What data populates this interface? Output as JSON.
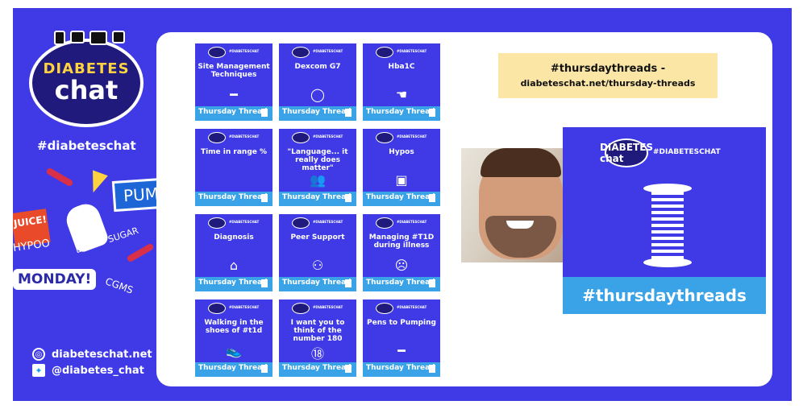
{
  "sidebar": {
    "logo_line1": "DIABETES",
    "logo_line2": "chat",
    "hashtag": "#diabeteschat",
    "collage": {
      "pump": "PUMP!",
      "juice": "JUICE!",
      "hypo": "HYPOO",
      "blood_sugar": "BLOOD SUGAR",
      "monday": "MONDAY!",
      "cgms": "CGMS"
    },
    "website": "diabeteschat.net",
    "twitter": "@diabetes_chat"
  },
  "tiles": [
    {
      "title": "Site Management Techniques",
      "glyph": "━"
    },
    {
      "title": "Dexcom G7",
      "glyph": "◯"
    },
    {
      "title": "Hba1C",
      "glyph": "☚"
    },
    {
      "title": "Time in range %",
      "glyph": ""
    },
    {
      "title": "\"Language... it really does matter\"",
      "glyph": "👥"
    },
    {
      "title": "Hypos",
      "glyph": "▣"
    },
    {
      "title": "Diagnosis",
      "glyph": "⌂"
    },
    {
      "title": "Peer Support",
      "glyph": "⚇"
    },
    {
      "title": "Managing #T1D during illness",
      "glyph": "☹"
    },
    {
      "title": "Walking in the shoes of #t1d",
      "glyph": "👟"
    },
    {
      "title": "I want you to think of the number 180",
      "glyph": "⑱"
    },
    {
      "title": "Pens to Pumping",
      "glyph": "━"
    }
  ],
  "tile_common": {
    "logo_tag": "#DIABETESCHAT",
    "bar_label": "Thursday Thread"
  },
  "banner": {
    "line1": "#thursdaythreads -",
    "line2": "diabeteschat.net/thursday-threads"
  },
  "feature": {
    "logo": "DIABETES chat",
    "tag": "#DIABETESCHAT",
    "bar": "#thursdaythreads"
  },
  "colors": {
    "brand_blue": "#3f3ae6",
    "bar_blue": "#3aa2e6",
    "banner_yellow": "#fbe6a6"
  }
}
